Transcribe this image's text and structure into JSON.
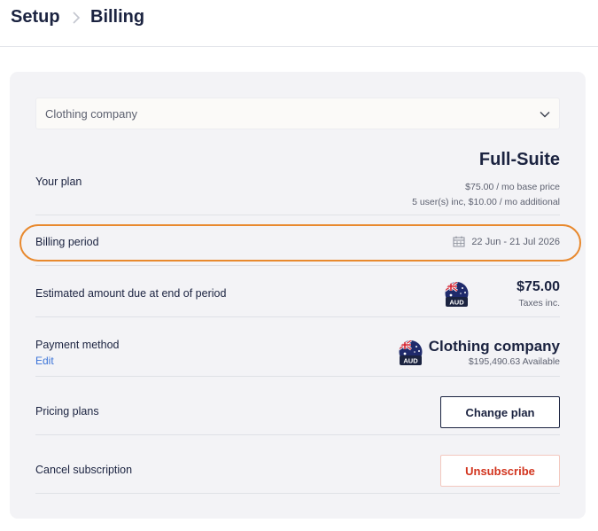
{
  "breadcrumb": {
    "root": "Setup",
    "current": "Billing"
  },
  "account_select": {
    "value": "Clothing company"
  },
  "plan": {
    "label": "Your plan",
    "name": "Full-Suite",
    "base_price": "$75.00 / mo base price",
    "users_info": "5 user(s) inc, $10.00 / mo additional"
  },
  "billing_period": {
    "label": "Billing period",
    "range": "22 Jun - 21 Jul 2026"
  },
  "estimated": {
    "label": "Estimated amount due at end of period",
    "currency": "AUD",
    "amount": "$75.00",
    "note": "Taxes inc."
  },
  "payment": {
    "label": "Payment method",
    "edit": "Edit",
    "currency": "AUD",
    "name": "Clothing company",
    "available": "$195,490.63 Available"
  },
  "pricing": {
    "label": "Pricing plans",
    "button": "Change plan"
  },
  "cancel": {
    "label": "Cancel subscription",
    "button": "Unsubscribe"
  },
  "colors": {
    "highlight": "#e8892e",
    "link": "#3c74d8",
    "danger": "#d2341e",
    "navy": "#1b2340"
  },
  "icons": {
    "separator": "chevron-right-icon",
    "dropdown": "chevron-down-icon",
    "calendar": "calendar-icon",
    "flag": "australia-flag-icon"
  }
}
